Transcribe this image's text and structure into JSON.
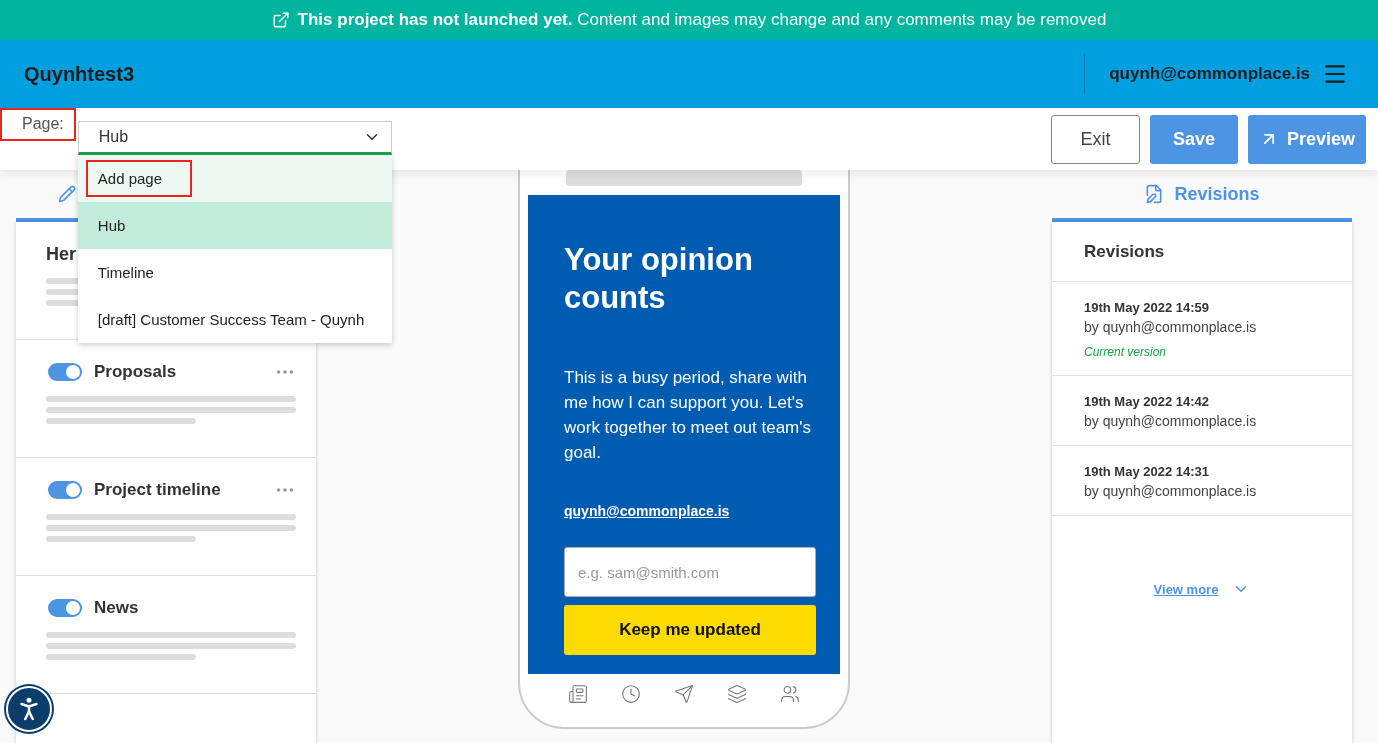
{
  "banner": {
    "title": "This project has not launched yet.",
    "text": "Content and images may change and any comments may be removed"
  },
  "header": {
    "project": "Quynhtest3",
    "user": "quynh@commonplace.is"
  },
  "toolbar": {
    "page_label": "Page:",
    "page_value": "Hub",
    "options": [
      {
        "label": "Add page",
        "kind": "action",
        "selected": false
      },
      {
        "label": "Hub",
        "kind": "page",
        "selected": true
      },
      {
        "label": "Timeline",
        "kind": "page",
        "selected": false
      },
      {
        "label": "[draft] Customer Success Team - Quynh",
        "kind": "page",
        "selected": false
      }
    ],
    "buttons": [
      {
        "label": "Exit",
        "kind": "secondary"
      },
      {
        "label": "Save",
        "kind": "primary"
      },
      {
        "label": "Preview",
        "kind": "preview"
      }
    ]
  },
  "sections": [
    {
      "title": "Her",
      "kind": "hero"
    },
    {
      "title": "Proposals",
      "kind": "toggle",
      "on": true,
      "menu": true
    },
    {
      "title": "Project timeline",
      "kind": "toggle",
      "on": true,
      "menu": true
    },
    {
      "title": "News",
      "kind": "toggle",
      "on": true,
      "menu": false
    }
  ],
  "phone": {
    "heading": "Your opinion counts",
    "body": "This is a busy period, share with me how I can support you. Let's work together to meet out team's goal.",
    "email": "quynh@commonplace.is",
    "placeholder": "e.g. sam@smith.com",
    "button": "Keep me updated"
  },
  "revisions": {
    "tab": "Revisions",
    "title": "Revisions",
    "items": [
      {
        "date": "19th May 2022 14:59",
        "author": "by quynh@commonplace.is",
        "current": true,
        "current_label": "Current version"
      },
      {
        "date": "19th May 2022 14:42",
        "author": "by quynh@commonplace.is",
        "current": false
      },
      {
        "date": "19th May 2022 14:31",
        "author": "by quynh@commonplace.is",
        "current": false
      }
    ],
    "view_more": "View more"
  }
}
